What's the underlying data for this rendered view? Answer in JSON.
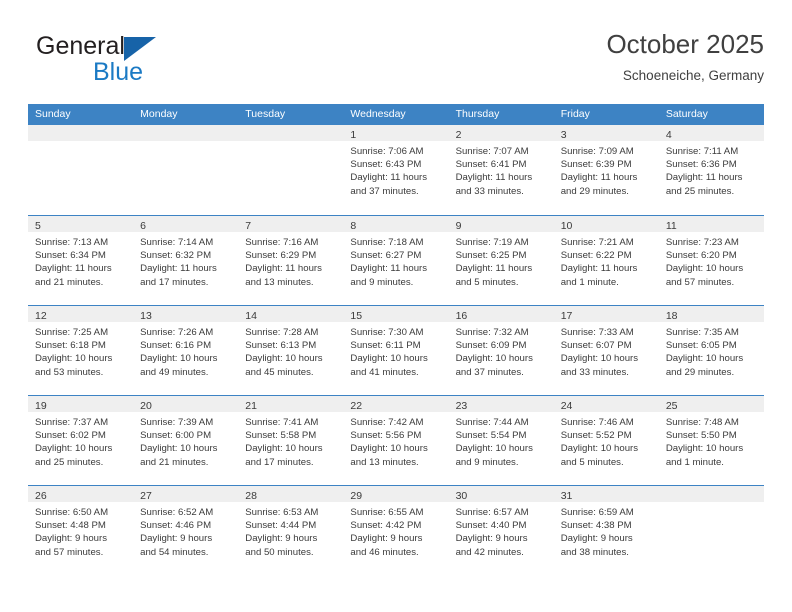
{
  "brand": {
    "name_part1": "General",
    "name_part2": "Blue",
    "logo_icon": "triangle-logo-icon"
  },
  "header": {
    "title": "October 2025",
    "subtitle": "Schoeneiche, Germany"
  },
  "colors": {
    "header_blue": "#3d83c4",
    "brand_blue": "#1b7ac4",
    "date_strip_gray": "#efefef",
    "text": "#3b3b3b"
  },
  "calendar": {
    "weekday_headers": [
      "Sunday",
      "Monday",
      "Tuesday",
      "Wednesday",
      "Thursday",
      "Friday",
      "Saturday"
    ],
    "weeks": [
      [
        {
          "date": "",
          "empty": true,
          "sunrise": "",
          "sunset": "",
          "daylight_1": "",
          "daylight_2": ""
        },
        {
          "date": "",
          "empty": true,
          "sunrise": "",
          "sunset": "",
          "daylight_1": "",
          "daylight_2": ""
        },
        {
          "date": "",
          "empty": true,
          "sunrise": "",
          "sunset": "",
          "daylight_1": "",
          "daylight_2": ""
        },
        {
          "date": "1",
          "empty": false,
          "sunrise": "Sunrise: 7:06 AM",
          "sunset": "Sunset: 6:43 PM",
          "daylight_1": "Daylight: 11 hours",
          "daylight_2": "and 37 minutes."
        },
        {
          "date": "2",
          "empty": false,
          "sunrise": "Sunrise: 7:07 AM",
          "sunset": "Sunset: 6:41 PM",
          "daylight_1": "Daylight: 11 hours",
          "daylight_2": "and 33 minutes."
        },
        {
          "date": "3",
          "empty": false,
          "sunrise": "Sunrise: 7:09 AM",
          "sunset": "Sunset: 6:39 PM",
          "daylight_1": "Daylight: 11 hours",
          "daylight_2": "and 29 minutes."
        },
        {
          "date": "4",
          "empty": false,
          "sunrise": "Sunrise: 7:11 AM",
          "sunset": "Sunset: 6:36 PM",
          "daylight_1": "Daylight: 11 hours",
          "daylight_2": "and 25 minutes."
        }
      ],
      [
        {
          "date": "5",
          "empty": false,
          "sunrise": "Sunrise: 7:13 AM",
          "sunset": "Sunset: 6:34 PM",
          "daylight_1": "Daylight: 11 hours",
          "daylight_2": "and 21 minutes."
        },
        {
          "date": "6",
          "empty": false,
          "sunrise": "Sunrise: 7:14 AM",
          "sunset": "Sunset: 6:32 PM",
          "daylight_1": "Daylight: 11 hours",
          "daylight_2": "and 17 minutes."
        },
        {
          "date": "7",
          "empty": false,
          "sunrise": "Sunrise: 7:16 AM",
          "sunset": "Sunset: 6:29 PM",
          "daylight_1": "Daylight: 11 hours",
          "daylight_2": "and 13 minutes."
        },
        {
          "date": "8",
          "empty": false,
          "sunrise": "Sunrise: 7:18 AM",
          "sunset": "Sunset: 6:27 PM",
          "daylight_1": "Daylight: 11 hours",
          "daylight_2": "and 9 minutes."
        },
        {
          "date": "9",
          "empty": false,
          "sunrise": "Sunrise: 7:19 AM",
          "sunset": "Sunset: 6:25 PM",
          "daylight_1": "Daylight: 11 hours",
          "daylight_2": "and 5 minutes."
        },
        {
          "date": "10",
          "empty": false,
          "sunrise": "Sunrise: 7:21 AM",
          "sunset": "Sunset: 6:22 PM",
          "daylight_1": "Daylight: 11 hours",
          "daylight_2": "and 1 minute."
        },
        {
          "date": "11",
          "empty": false,
          "sunrise": "Sunrise: 7:23 AM",
          "sunset": "Sunset: 6:20 PM",
          "daylight_1": "Daylight: 10 hours",
          "daylight_2": "and 57 minutes."
        }
      ],
      [
        {
          "date": "12",
          "empty": false,
          "sunrise": "Sunrise: 7:25 AM",
          "sunset": "Sunset: 6:18 PM",
          "daylight_1": "Daylight: 10 hours",
          "daylight_2": "and 53 minutes."
        },
        {
          "date": "13",
          "empty": false,
          "sunrise": "Sunrise: 7:26 AM",
          "sunset": "Sunset: 6:16 PM",
          "daylight_1": "Daylight: 10 hours",
          "daylight_2": "and 49 minutes."
        },
        {
          "date": "14",
          "empty": false,
          "sunrise": "Sunrise: 7:28 AM",
          "sunset": "Sunset: 6:13 PM",
          "daylight_1": "Daylight: 10 hours",
          "daylight_2": "and 45 minutes."
        },
        {
          "date": "15",
          "empty": false,
          "sunrise": "Sunrise: 7:30 AM",
          "sunset": "Sunset: 6:11 PM",
          "daylight_1": "Daylight: 10 hours",
          "daylight_2": "and 41 minutes."
        },
        {
          "date": "16",
          "empty": false,
          "sunrise": "Sunrise: 7:32 AM",
          "sunset": "Sunset: 6:09 PM",
          "daylight_1": "Daylight: 10 hours",
          "daylight_2": "and 37 minutes."
        },
        {
          "date": "17",
          "empty": false,
          "sunrise": "Sunrise: 7:33 AM",
          "sunset": "Sunset: 6:07 PM",
          "daylight_1": "Daylight: 10 hours",
          "daylight_2": "and 33 minutes."
        },
        {
          "date": "18",
          "empty": false,
          "sunrise": "Sunrise: 7:35 AM",
          "sunset": "Sunset: 6:05 PM",
          "daylight_1": "Daylight: 10 hours",
          "daylight_2": "and 29 minutes."
        }
      ],
      [
        {
          "date": "19",
          "empty": false,
          "sunrise": "Sunrise: 7:37 AM",
          "sunset": "Sunset: 6:02 PM",
          "daylight_1": "Daylight: 10 hours",
          "daylight_2": "and 25 minutes."
        },
        {
          "date": "20",
          "empty": false,
          "sunrise": "Sunrise: 7:39 AM",
          "sunset": "Sunset: 6:00 PM",
          "daylight_1": "Daylight: 10 hours",
          "daylight_2": "and 21 minutes."
        },
        {
          "date": "21",
          "empty": false,
          "sunrise": "Sunrise: 7:41 AM",
          "sunset": "Sunset: 5:58 PM",
          "daylight_1": "Daylight: 10 hours",
          "daylight_2": "and 17 minutes."
        },
        {
          "date": "22",
          "empty": false,
          "sunrise": "Sunrise: 7:42 AM",
          "sunset": "Sunset: 5:56 PM",
          "daylight_1": "Daylight: 10 hours",
          "daylight_2": "and 13 minutes."
        },
        {
          "date": "23",
          "empty": false,
          "sunrise": "Sunrise: 7:44 AM",
          "sunset": "Sunset: 5:54 PM",
          "daylight_1": "Daylight: 10 hours",
          "daylight_2": "and 9 minutes."
        },
        {
          "date": "24",
          "empty": false,
          "sunrise": "Sunrise: 7:46 AM",
          "sunset": "Sunset: 5:52 PM",
          "daylight_1": "Daylight: 10 hours",
          "daylight_2": "and 5 minutes."
        },
        {
          "date": "25",
          "empty": false,
          "sunrise": "Sunrise: 7:48 AM",
          "sunset": "Sunset: 5:50 PM",
          "daylight_1": "Daylight: 10 hours",
          "daylight_2": "and 1 minute."
        }
      ],
      [
        {
          "date": "26",
          "empty": false,
          "sunrise": "Sunrise: 6:50 AM",
          "sunset": "Sunset: 4:48 PM",
          "daylight_1": "Daylight: 9 hours",
          "daylight_2": "and 57 minutes."
        },
        {
          "date": "27",
          "empty": false,
          "sunrise": "Sunrise: 6:52 AM",
          "sunset": "Sunset: 4:46 PM",
          "daylight_1": "Daylight: 9 hours",
          "daylight_2": "and 54 minutes."
        },
        {
          "date": "28",
          "empty": false,
          "sunrise": "Sunrise: 6:53 AM",
          "sunset": "Sunset: 4:44 PM",
          "daylight_1": "Daylight: 9 hours",
          "daylight_2": "and 50 minutes."
        },
        {
          "date": "29",
          "empty": false,
          "sunrise": "Sunrise: 6:55 AM",
          "sunset": "Sunset: 4:42 PM",
          "daylight_1": "Daylight: 9 hours",
          "daylight_2": "and 46 minutes."
        },
        {
          "date": "30",
          "empty": false,
          "sunrise": "Sunrise: 6:57 AM",
          "sunset": "Sunset: 4:40 PM",
          "daylight_1": "Daylight: 9 hours",
          "daylight_2": "and 42 minutes."
        },
        {
          "date": "31",
          "empty": false,
          "sunrise": "Sunrise: 6:59 AM",
          "sunset": "Sunset: 4:38 PM",
          "daylight_1": "Daylight: 9 hours",
          "daylight_2": "and 38 minutes."
        },
        {
          "date": "",
          "empty": true,
          "sunrise": "",
          "sunset": "",
          "daylight_1": "",
          "daylight_2": ""
        }
      ]
    ]
  }
}
